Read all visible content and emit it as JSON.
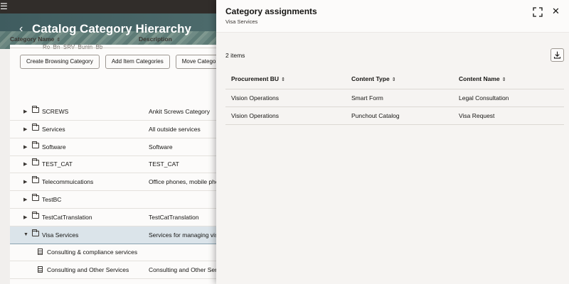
{
  "page": {
    "title": "Catalog Category Hierarchy",
    "toolbar": [
      "Create Browsing Category",
      "Add Item Categories",
      "Move Category"
    ],
    "tree_columns": {
      "name": "Category Name",
      "description": "Description"
    },
    "partial_row_text": "Ro_Bn_SRV_Bunin_Bb",
    "tree_rows": [
      {
        "name": "SCREWS",
        "description": "Ankit Screws Category"
      },
      {
        "name": "Services",
        "description": "All outside services"
      },
      {
        "name": "Software",
        "description": "Software"
      },
      {
        "name": "TEST_CAT",
        "description": "TEST_CAT"
      },
      {
        "name": "Telecommuications",
        "description": "Office phones, mobile phones"
      },
      {
        "name": "TestBC",
        "description": ""
      },
      {
        "name": "TestCatTranslation",
        "description": "TestCatTranslation"
      },
      {
        "name": "Visa Services",
        "description": "Services for managing visas"
      },
      {
        "name": "Consulting & compliance services",
        "description": ""
      },
      {
        "name": "Consulting and Other Services",
        "description": "Consulting and Other Services"
      }
    ]
  },
  "drawer": {
    "title": "Category assignments",
    "subtitle": "Visa Services",
    "count_label": "2 items",
    "columns": [
      "Procurement BU",
      "Content Type",
      "Content Name"
    ],
    "rows": [
      [
        "Vision Operations",
        "Smart Form",
        "Legal Consultation"
      ],
      [
        "Vision Operations",
        "Punchout Catalog",
        "Visa Request"
      ]
    ]
  },
  "icons": {
    "menu": "hamburger-icon",
    "back": "chevron-left-icon",
    "expand": "fullscreen-icon",
    "close": "close-icon",
    "download": "download-icon",
    "sort": "sort-icon"
  },
  "colors": {
    "accent_selected_row": "#dbe4ea",
    "topbar": "#312d2a"
  }
}
